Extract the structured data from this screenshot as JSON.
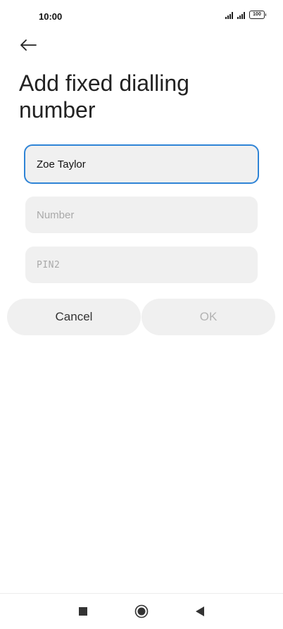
{
  "status_bar": {
    "time": "10:00",
    "battery": "100"
  },
  "header": {
    "title": "Add fixed dialling number"
  },
  "form": {
    "name": {
      "value": "Zoe Taylor",
      "placeholder": ""
    },
    "number": {
      "value": "",
      "placeholder": "Number"
    },
    "pin2": {
      "value": "",
      "placeholder": "PIN2"
    }
  },
  "actions": {
    "cancel_label": "Cancel",
    "ok_label": "OK"
  },
  "colors": {
    "accent": "#2f84d6",
    "field_bg": "#f0f0f0",
    "disabled_text": "#b3b3b3"
  },
  "icons": {
    "back": "arrow-left-icon",
    "recents": "square-icon",
    "home": "circle-icon",
    "nav_back": "triangle-left-icon"
  }
}
